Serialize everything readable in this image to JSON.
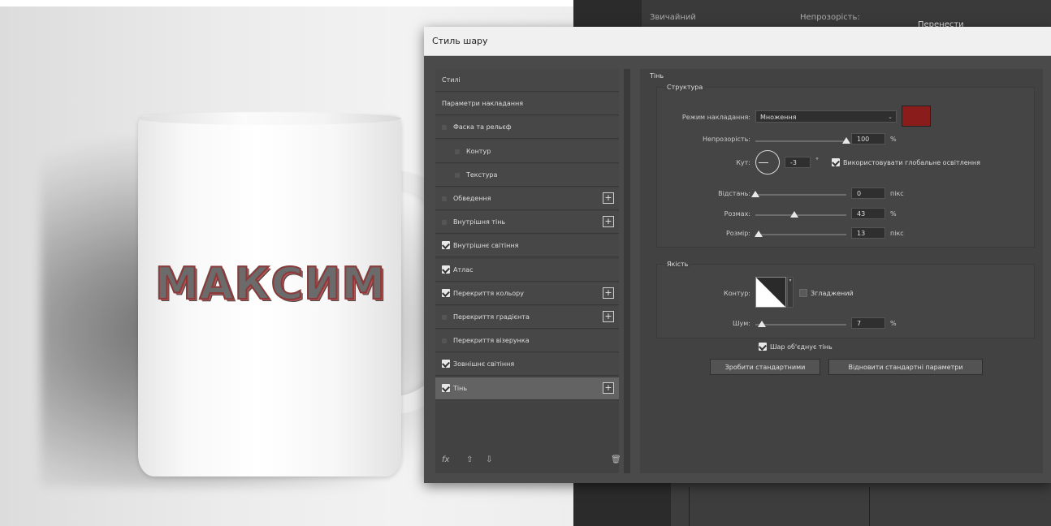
{
  "photo": {
    "mug_text": "МАКСИМ"
  },
  "workspace": {
    "top_left": "Звичайний",
    "top_mid": "Непрозорість:",
    "top_right": "Перенести"
  },
  "dialog": {
    "title": "Стиль шару",
    "styles_list": {
      "items": [
        {
          "label": "Стилі",
          "checkbox": "none",
          "has_plus": false,
          "active": false
        },
        {
          "label": "Параметри накладання",
          "checkbox": "none",
          "has_plus": false,
          "active": false
        },
        {
          "label": "Фаска та рельєф",
          "checkbox": "off",
          "has_plus": false,
          "active": false
        },
        {
          "label": "Контур",
          "checkbox": "off",
          "has_plus": false,
          "active": false
        },
        {
          "label": "Текстура",
          "checkbox": "off",
          "has_plus": false,
          "active": false
        },
        {
          "label": "Обведення",
          "checkbox": "off",
          "has_plus": true,
          "active": false
        },
        {
          "label": "Внутрішня тінь",
          "checkbox": "off",
          "has_plus": true,
          "active": false
        },
        {
          "label": "Внутрішнє світіння",
          "checkbox": "on",
          "has_plus": false,
          "active": false
        },
        {
          "label": "Атлас",
          "checkbox": "on",
          "has_plus": false,
          "active": false
        },
        {
          "label": "Перекриття кольору",
          "checkbox": "on",
          "has_plus": true,
          "active": false
        },
        {
          "label": "Перекриття градієнта",
          "checkbox": "off",
          "has_plus": true,
          "active": false
        },
        {
          "label": "Перекриття візерунка",
          "checkbox": "off",
          "has_plus": false,
          "active": false
        },
        {
          "label": "Зовнішнє світіння",
          "checkbox": "on",
          "has_plus": false,
          "active": false
        },
        {
          "label": "Тінь",
          "checkbox": "on",
          "has_plus": true,
          "active": true
        }
      ],
      "footer_icons": [
        "fx-icon",
        "arrow-up-icon",
        "arrow-down-icon",
        "trash-icon"
      ],
      "footer_fx": "fx"
    },
    "shadow": {
      "section_title": "Тінь",
      "structure": {
        "title": "Структура",
        "blend_mode_label": "Режим накладання:",
        "blend_mode_value": "Множення",
        "shadow_color": "#8a1c1c",
        "opacity_label": "Непрозорість:",
        "opacity_value": "100",
        "opacity_unit": "%",
        "opacity_fraction": 1.0,
        "angle_label": "Кут:",
        "angle_value": "-3",
        "angle_unit": "°",
        "global_light_label": "Використовувати глобальне освітлення",
        "global_light_checked": true,
        "distance_label": "Відстань:",
        "distance_value": "0",
        "distance_unit": "пікс",
        "distance_fraction": 0.0,
        "spread_label": "Розмах:",
        "spread_value": "43",
        "spread_unit": "%",
        "spread_fraction": 0.43,
        "size_label": "Розмір:",
        "size_value": "13",
        "size_unit": "пікс",
        "size_fraction": 0.04
      },
      "quality": {
        "title": "Якість",
        "contour_label": "Контур:",
        "smoothed_label": "Згладжений",
        "smoothed_checked": false,
        "noise_label": "Шум:",
        "noise_value": "7",
        "noise_unit": "%",
        "noise_fraction": 0.07
      },
      "knockout_label": "Шар об'єднує тінь",
      "knockout_checked": true,
      "make_default_button": "Зробити стандартними",
      "reset_default_button": "Відновити стандартні параметри"
    }
  }
}
